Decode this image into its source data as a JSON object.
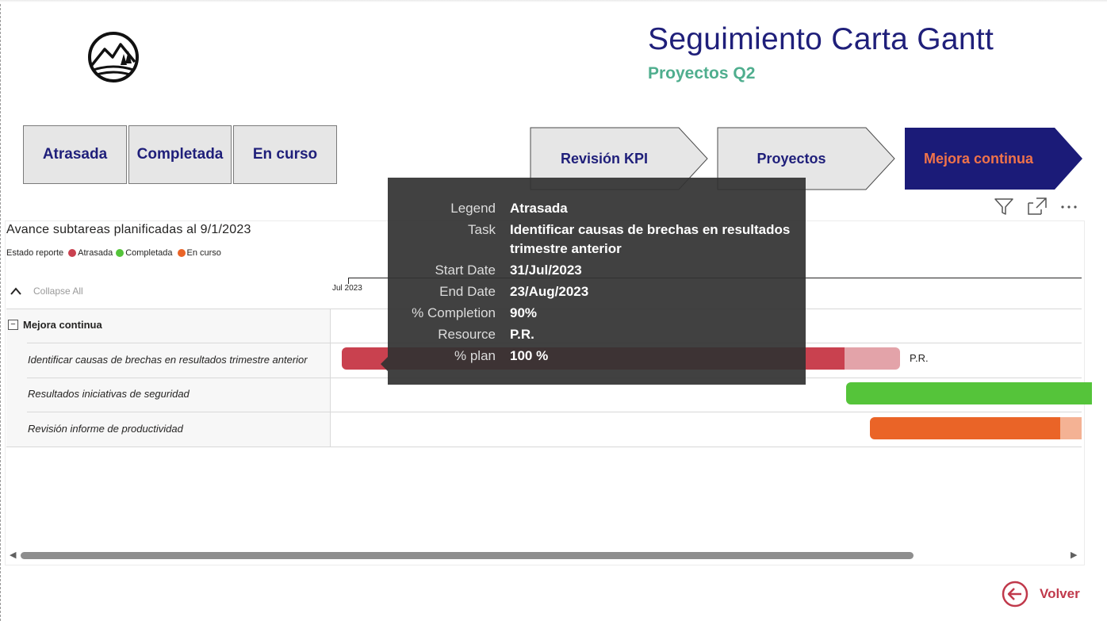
{
  "header": {
    "title": "Seguimiento Carta Gantt",
    "subtitle": "Proyectos Q2"
  },
  "filters": [
    {
      "label": "Atrasada"
    },
    {
      "label": "Completada"
    },
    {
      "label": "En curso"
    }
  ],
  "nav": [
    {
      "label": "Revisión KPI",
      "active": false
    },
    {
      "label": "Proyectos",
      "active": false
    },
    {
      "label": "Mejora continua",
      "active": true
    }
  ],
  "colors": {
    "title": "#1f1f7a",
    "subtitle": "#4fae8e",
    "nav_active_bg": "#1b1b78",
    "nav_active_text": "#f0734a",
    "atrasada": "#c9414f",
    "atrasada_light": "#e3a3a9",
    "completada": "#55c43a",
    "en_curso": "#ea6427",
    "en_curso_light": "#f4b294",
    "volver": "#c0394b"
  },
  "gantt": {
    "title": "Avance subtareas planificadas al 9/1/2023",
    "legend_title": "Estado reporte",
    "legend": [
      {
        "label": "Atrasada",
        "color": "#c9414f"
      },
      {
        "label": "Completada",
        "color": "#55c43a"
      },
      {
        "label": "En curso",
        "color": "#ea6427"
      }
    ],
    "collapse_label": "Collapse All",
    "month_label": "Jul 2023",
    "group": "Mejora continua",
    "tasks": [
      {
        "name": "Identificar causas de brechas en resultados trimestre anterior",
        "status": "Atrasada",
        "completion": 0.9,
        "resource": "P.R."
      },
      {
        "name": "Resultados iniciativas de seguridad",
        "status": "Completada",
        "completion": 1.0,
        "resource": ""
      },
      {
        "name": "Revisión informe de productividad",
        "status": "En curso",
        "completion": 0.9,
        "resource": ""
      }
    ]
  },
  "tooltip": {
    "rows": [
      {
        "key": "Legend",
        "value": "Atrasada"
      },
      {
        "key": "Task",
        "value": "Identificar causas de brechas en resultados trimestre anterior"
      },
      {
        "key": "Start Date",
        "value": "31/Jul/2023"
      },
      {
        "key": "End Date",
        "value": "23/Aug/2023"
      },
      {
        "key": "% Completion",
        "value": "90%"
      },
      {
        "key": "Resource",
        "value": "P.R."
      },
      {
        "key": "% plan",
        "value": "100 %"
      }
    ]
  },
  "footer": {
    "back_label": "Volver"
  },
  "icons": [
    "mountain-logo-icon",
    "filter-icon",
    "focus-mode-icon",
    "more-options-icon",
    "chevron-up-icon",
    "back-arrow-icon"
  ]
}
